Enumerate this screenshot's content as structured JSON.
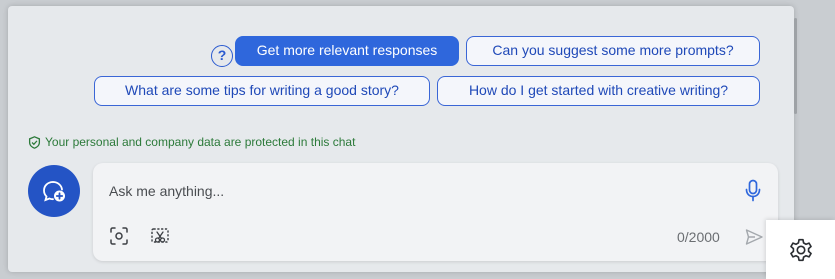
{
  "suggestions": {
    "help_icon": "question-circle-icon",
    "primary_label": "Get more relevant responses",
    "items": [
      "Can you suggest some more prompts?",
      "What are some tips for writing a good story?",
      "How do I get started with creative writing?"
    ]
  },
  "privacy_notice": "Your personal and company data are protected in this chat",
  "composer": {
    "placeholder": "Ask me anything...",
    "char_count": "0/2000",
    "icons": [
      "new-topic-icon",
      "microphone-icon",
      "screenshot-icon",
      "snip-icon",
      "send-icon"
    ]
  },
  "settings": {
    "icon": "gear-icon"
  },
  "colors": {
    "accent": "#2f67dc",
    "privacy_green": "#2c7a3a",
    "panel_bg": "#e6e9ec"
  }
}
